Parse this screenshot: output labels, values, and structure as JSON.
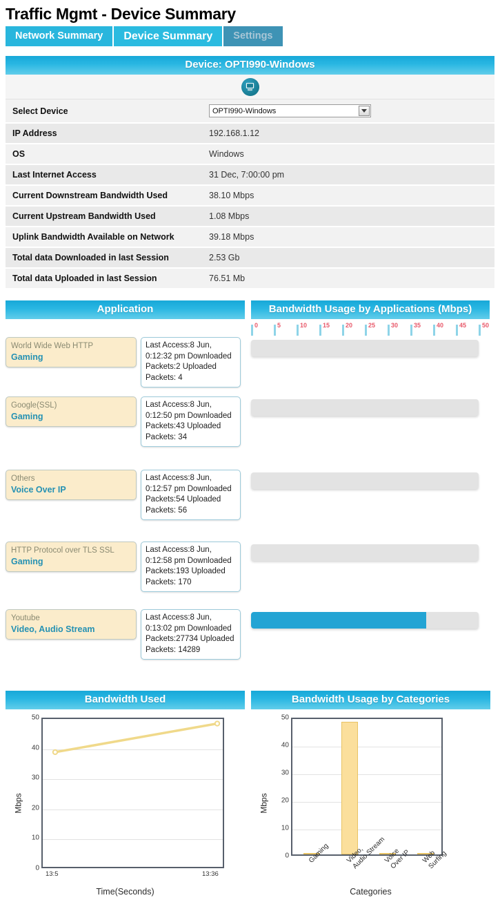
{
  "header": {
    "title": "Traffic Mgmt - Device Summary",
    "tabs": [
      {
        "label": "Network Summary",
        "state": "normal"
      },
      {
        "label": "Device Summary",
        "state": "active"
      },
      {
        "label": "Settings",
        "state": "disabled"
      }
    ]
  },
  "device_panel": {
    "heading": "Device: OPTI990-Windows",
    "icon": "desktop-computer-icon",
    "rows": [
      {
        "label": "Select Device",
        "value": "OPTI990-Windows",
        "type": "select"
      },
      {
        "label": "IP Address",
        "value": "192.168.1.12",
        "type": "text"
      },
      {
        "label": "OS",
        "value": "Windows",
        "type": "text"
      },
      {
        "label": "Last Internet Access",
        "value": "31 Dec, 7:00:00 pm",
        "type": "text"
      },
      {
        "label": "Current Downstream Bandwidth Used",
        "value": "38.10 Mbps",
        "type": "text"
      },
      {
        "label": "Current Upstream Bandwidth Used",
        "value": "1.08 Mbps",
        "type": "text"
      },
      {
        "label": "Uplink Bandwidth Available on Network",
        "value": "39.18 Mbps",
        "type": "text"
      },
      {
        "label": "Total data Downloaded in last Session",
        "value": "2.53 Gb",
        "type": "text"
      },
      {
        "label": "Total data Uploaded in last Session",
        "value": "76.51 Mb",
        "type": "text"
      }
    ],
    "select_options": [
      "OPTI990-Windows"
    ]
  },
  "application_panel": {
    "heading": "Application",
    "bandwidth_heading": "Bandwidth Usage by Applications (Mbps)",
    "ruler_ticks": [
      0,
      5,
      10,
      15,
      20,
      25,
      30,
      35,
      40,
      45,
      50
    ],
    "ruler_max": 50,
    "applications": [
      {
        "name": "World Wide Web HTTP",
        "category": "Gaming",
        "details": "Last Access:8 Jun, 0:12:32 pm Downloaded Packets:2 Uploaded Packets: 4",
        "last_access": "8 Jun, 0:12:32 pm",
        "downloaded_packets": "2",
        "uploaded_packets": "4",
        "bandwidth_mbps": 0.0
      },
      {
        "name": "Google(SSL)",
        "category": "Gaming",
        "details": "Last Access:8 Jun, 0:12:50 pm Downloaded Packets:43 Uploaded Packets: 34",
        "last_access": "8 Jun, 0:12:50 pm",
        "downloaded_packets": "43",
        "uploaded_packets": "34",
        "bandwidth_mbps": 0.0
      },
      {
        "name": "Others",
        "category": "Voice Over IP",
        "details": "Last Access:8 Jun, 0:12:57 pm Downloaded Packets:54 Uploaded Packets: 56",
        "last_access": "8 Jun, 0:12:57 pm",
        "downloaded_packets": "54",
        "uploaded_packets": "56",
        "bandwidth_mbps": 0.0
      },
      {
        "name": "HTTP Protocol over TLS SSL",
        "category": "Gaming",
        "details": "Last Access:8 Jun, 0:12:58 pm Downloaded Packets:193 Uploaded Packets: 170",
        "last_access": "8 Jun, 0:12:58 pm",
        "downloaded_packets": "193",
        "uploaded_packets": "170",
        "bandwidth_mbps": 0.0
      },
      {
        "name": "Youtube",
        "category": "Video, Audio Stream",
        "details": "Last Access:8 Jun, 0:13:02 pm Downloaded Packets:27734 Uploaded Packets: 14289",
        "last_access": "8 Jun, 0:13:02 pm",
        "downloaded_packets": "27734",
        "uploaded_packets": "14289",
        "bandwidth_mbps": 38.5
      }
    ],
    "detail_prefixes": {
      "last_access": "Last Access:",
      "downloaded": "Downloaded Packets:",
      "uploaded": "Uploaded Packets: "
    }
  },
  "colors": {
    "accent": "#29b6dd",
    "panel_head_top": "#18a8d8",
    "panel_head_bottom": "#62cdea",
    "bar_fill": "#23a4d4",
    "bar_track": "#e3e3e3",
    "app_box": "#fbeccb",
    "app_category_text": "#2591b3",
    "ruler_label": "#e8596a",
    "chart_series": "#f0d98a",
    "tab_disabled": "#3e93b5"
  },
  "chart_data": [
    {
      "id": "bandwidth-used",
      "type": "line",
      "title": "Bandwidth Used",
      "xlabel": "Time(Seconds)",
      "ylabel": "Mbps",
      "x": [
        "13:5",
        "13:36"
      ],
      "values": [
        39.0,
        48.5
      ],
      "yticks": [
        0,
        10,
        20,
        30,
        40,
        50
      ],
      "ylim": [
        0,
        50
      ],
      "grid": true,
      "legend": "none",
      "series_color": "#f0d98a",
      "marker": "circle"
    },
    {
      "id": "bandwidth-by-categories",
      "type": "bar",
      "title": "Bandwidth Usage by Categories",
      "xlabel": "Categories",
      "ylabel": "Mbps",
      "categories": [
        "Gaming",
        "Video, Audio Stream",
        "Voice Over IP",
        "Web Surfing"
      ],
      "category_lines": [
        [
          "Gaming"
        ],
        [
          "Video,",
          "Audio Stream"
        ],
        [
          "Voice",
          "Over IP"
        ],
        [
          "Web",
          "Surfing"
        ]
      ],
      "values": [
        0.3,
        48.0,
        0.3,
        0.6
      ],
      "yticks": [
        0,
        10,
        20,
        30,
        40,
        50
      ],
      "ylim": [
        0,
        50
      ],
      "grid": true,
      "legend": "none",
      "bar_color": "#fbdf9c"
    }
  ]
}
